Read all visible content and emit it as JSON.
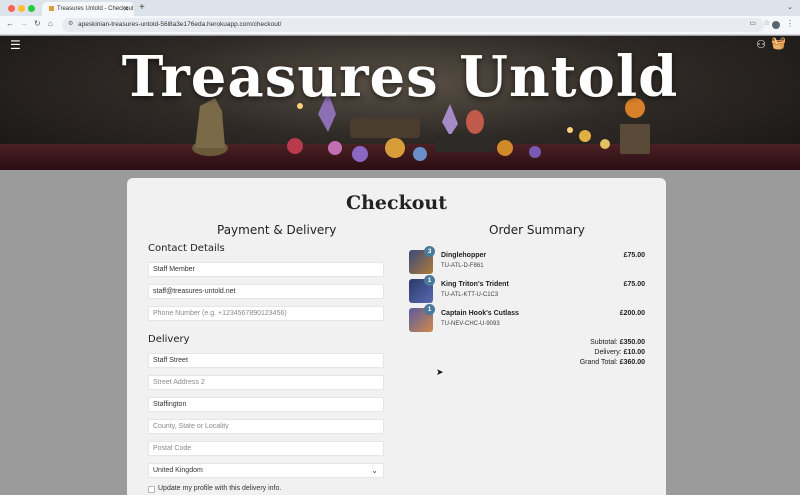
{
  "browser": {
    "tab_title": "Treasures Untold - Checkout",
    "url": "apeskinian-treasures-untold-56l8a3e176eda.herokuapp.com/checkout/"
  },
  "site": {
    "title": "Treasures Untold"
  },
  "checkout": {
    "title": "Checkout",
    "payment_heading": "Payment & Delivery",
    "contact_heading": "Contact Details",
    "contact": {
      "full_name": "Staff Member",
      "email": "staff@treasures-untold.net",
      "phone_placeholder": "Phone Number (e.g. +1234567890123456)"
    },
    "delivery_heading": "Delivery",
    "delivery": {
      "street1": "Staff Street",
      "street2_placeholder": "Street Address 2",
      "town": "Staffington",
      "county_placeholder": "County, State or Locality",
      "postcode_placeholder": "Postal Code",
      "country": "United Kingdom"
    },
    "save_info_label": "Update my profile with this delivery info."
  },
  "order_summary": {
    "heading": "Order Summary",
    "items": [
      {
        "name": "Dinglehopper",
        "sku": "TU-ATL-D-F861",
        "price": "£75.00",
        "qty": "3"
      },
      {
        "name": "King Triton's Trident",
        "sku": "TU-ATL-KTT-U-C1C3",
        "price": "£75.00",
        "qty": "1"
      },
      {
        "name": "Captain Hook's Cutlass",
        "sku": "TU-NEV-CHC-U-9093",
        "price": "£200.00",
        "qty": "1"
      }
    ],
    "subtotal_label": "Subtotal:",
    "subtotal": "£350.00",
    "delivery_label": "Delivery:",
    "delivery": "£10.00",
    "grand_total_label": "Grand Total:",
    "grand_total": "£360.00"
  },
  "colors": {
    "badge": "#4a7a9a",
    "card_bg": "#f1f1f1",
    "page_bg": "#9b9b9b"
  }
}
